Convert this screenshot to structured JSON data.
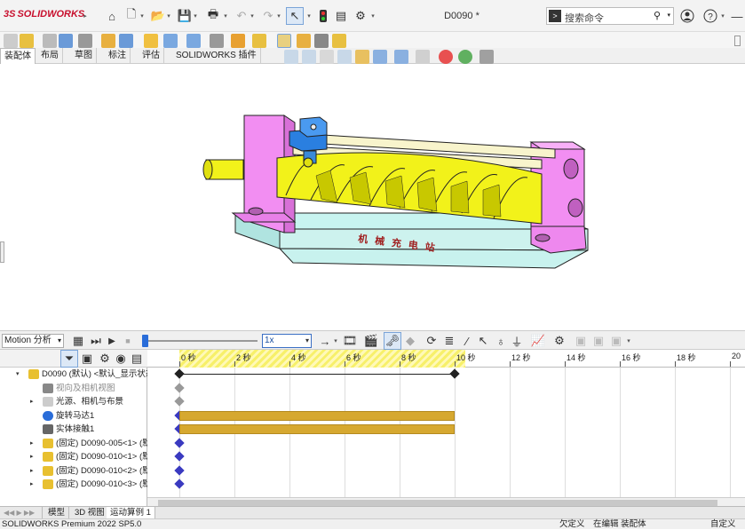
{
  "app": {
    "brand": "SOLIDWORKS",
    "brand_prefix": "3S",
    "document_title": "D0090 *"
  },
  "search": {
    "placeholder": "搜索命令"
  },
  "ribbon_tabs": [
    {
      "label": "装配体",
      "active": true
    },
    {
      "label": "布局",
      "active": false
    },
    {
      "label": "草图",
      "active": false
    },
    {
      "label": "标注",
      "active": false
    },
    {
      "label": "评估",
      "active": false
    },
    {
      "label": "SOLIDWORKS 插件",
      "active": false
    }
  ],
  "model": {
    "engraved_text": "机械充电站",
    "colors": {
      "frame": "#f08ef0",
      "base": "#c8f0f0",
      "cam": "#f2f21a",
      "rod": "#f8f2c8",
      "block": "#2a7fe0"
    }
  },
  "motion": {
    "study_type": "Motion 分析",
    "speed": "1x",
    "time_ticks": [
      "0 秒",
      "2 秒",
      "4 秒",
      "6 秒",
      "8 秒",
      "10 秒",
      "12 秒",
      "14 秒",
      "16 秒",
      "18 秒",
      "20"
    ],
    "tree": [
      {
        "label": "D0090 (默认) <默认_显示状态",
        "expand": "▾",
        "icon": "assembly",
        "indent": 0
      },
      {
        "label": "视向及相机视图",
        "expand": "",
        "icon": "camera",
        "indent": 1,
        "dim": true
      },
      {
        "label": "光源、相机与布景",
        "expand": "▸",
        "icon": "lights",
        "indent": 1
      },
      {
        "label": "旋转马达1",
        "expand": "",
        "icon": "motor",
        "indent": 1
      },
      {
        "label": "实体接触1",
        "expand": "",
        "icon": "contact",
        "indent": 1
      },
      {
        "label": "(固定) D0090-005<1> (默",
        "expand": "▸",
        "icon": "part",
        "indent": 1
      },
      {
        "label": "(固定) D0090-010<1> (默",
        "expand": "▸",
        "icon": "part",
        "indent": 1
      },
      {
        "label": "(固定) D0090-010<2> (默",
        "expand": "▸",
        "icon": "part",
        "indent": 1
      },
      {
        "label": "(固定) D0090-010<3> (默",
        "expand": "▸",
        "icon": "part",
        "indent": 1
      }
    ],
    "bar_end_seconds": 10,
    "bottom_tabs": [
      {
        "label": "模型",
        "active": false
      },
      {
        "label": "3D 视图",
        "active": false
      },
      {
        "label": "运动算例 1",
        "active": true
      }
    ]
  },
  "status": {
    "product": "SOLIDWORKS Premium 2022 SP5.0",
    "state": "欠定义",
    "mode": "在编辑 装配体",
    "custom": "自定义"
  }
}
